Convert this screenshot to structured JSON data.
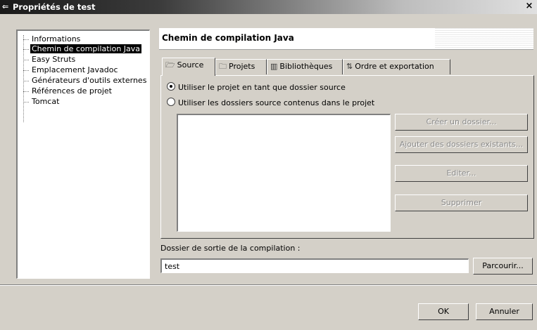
{
  "window": {
    "title": "Propriétés de test",
    "close_glyph": "×"
  },
  "tree": {
    "items": [
      {
        "label": "Informations",
        "selected": false
      },
      {
        "label": "Chemin de compilation Java",
        "selected": true
      },
      {
        "label": "Easy Struts",
        "selected": false
      },
      {
        "label": "Emplacement Javadoc",
        "selected": false
      },
      {
        "label": "Générateurs d'outils externes",
        "selected": false
      },
      {
        "label": "Références de projet",
        "selected": false
      },
      {
        "label": "Tomcat",
        "selected": false
      }
    ]
  },
  "page": {
    "title": "Chemin de compilation Java"
  },
  "tabs": [
    {
      "label": "Source",
      "icon": "folder-open-icon",
      "active": true
    },
    {
      "label": "Projets",
      "icon": "folder-icon",
      "active": false
    },
    {
      "label": "Bibliothèques",
      "icon": "library-icon",
      "active": false
    },
    {
      "label": "Ordre et exportation",
      "icon": "sort-arrows-icon",
      "active": false
    }
  ],
  "source_tab": {
    "radio_project": {
      "label": "Utiliser le projet en tant que dossier source",
      "checked": true
    },
    "radio_folders": {
      "label": "Utiliser les dossiers source contenus dans le projet",
      "checked": false
    },
    "buttons": {
      "create_folder": "Créer un dossier...",
      "add_existing": "Ajouter des dossiers existants...",
      "edit": "Editer...",
      "delete": "Supprimer"
    }
  },
  "output": {
    "label": "Dossier de sortie de la compilation :",
    "value": "test",
    "browse_label": "Parcourir..."
  },
  "footer": {
    "ok_label": "OK",
    "cancel_label": "Annuler"
  }
}
